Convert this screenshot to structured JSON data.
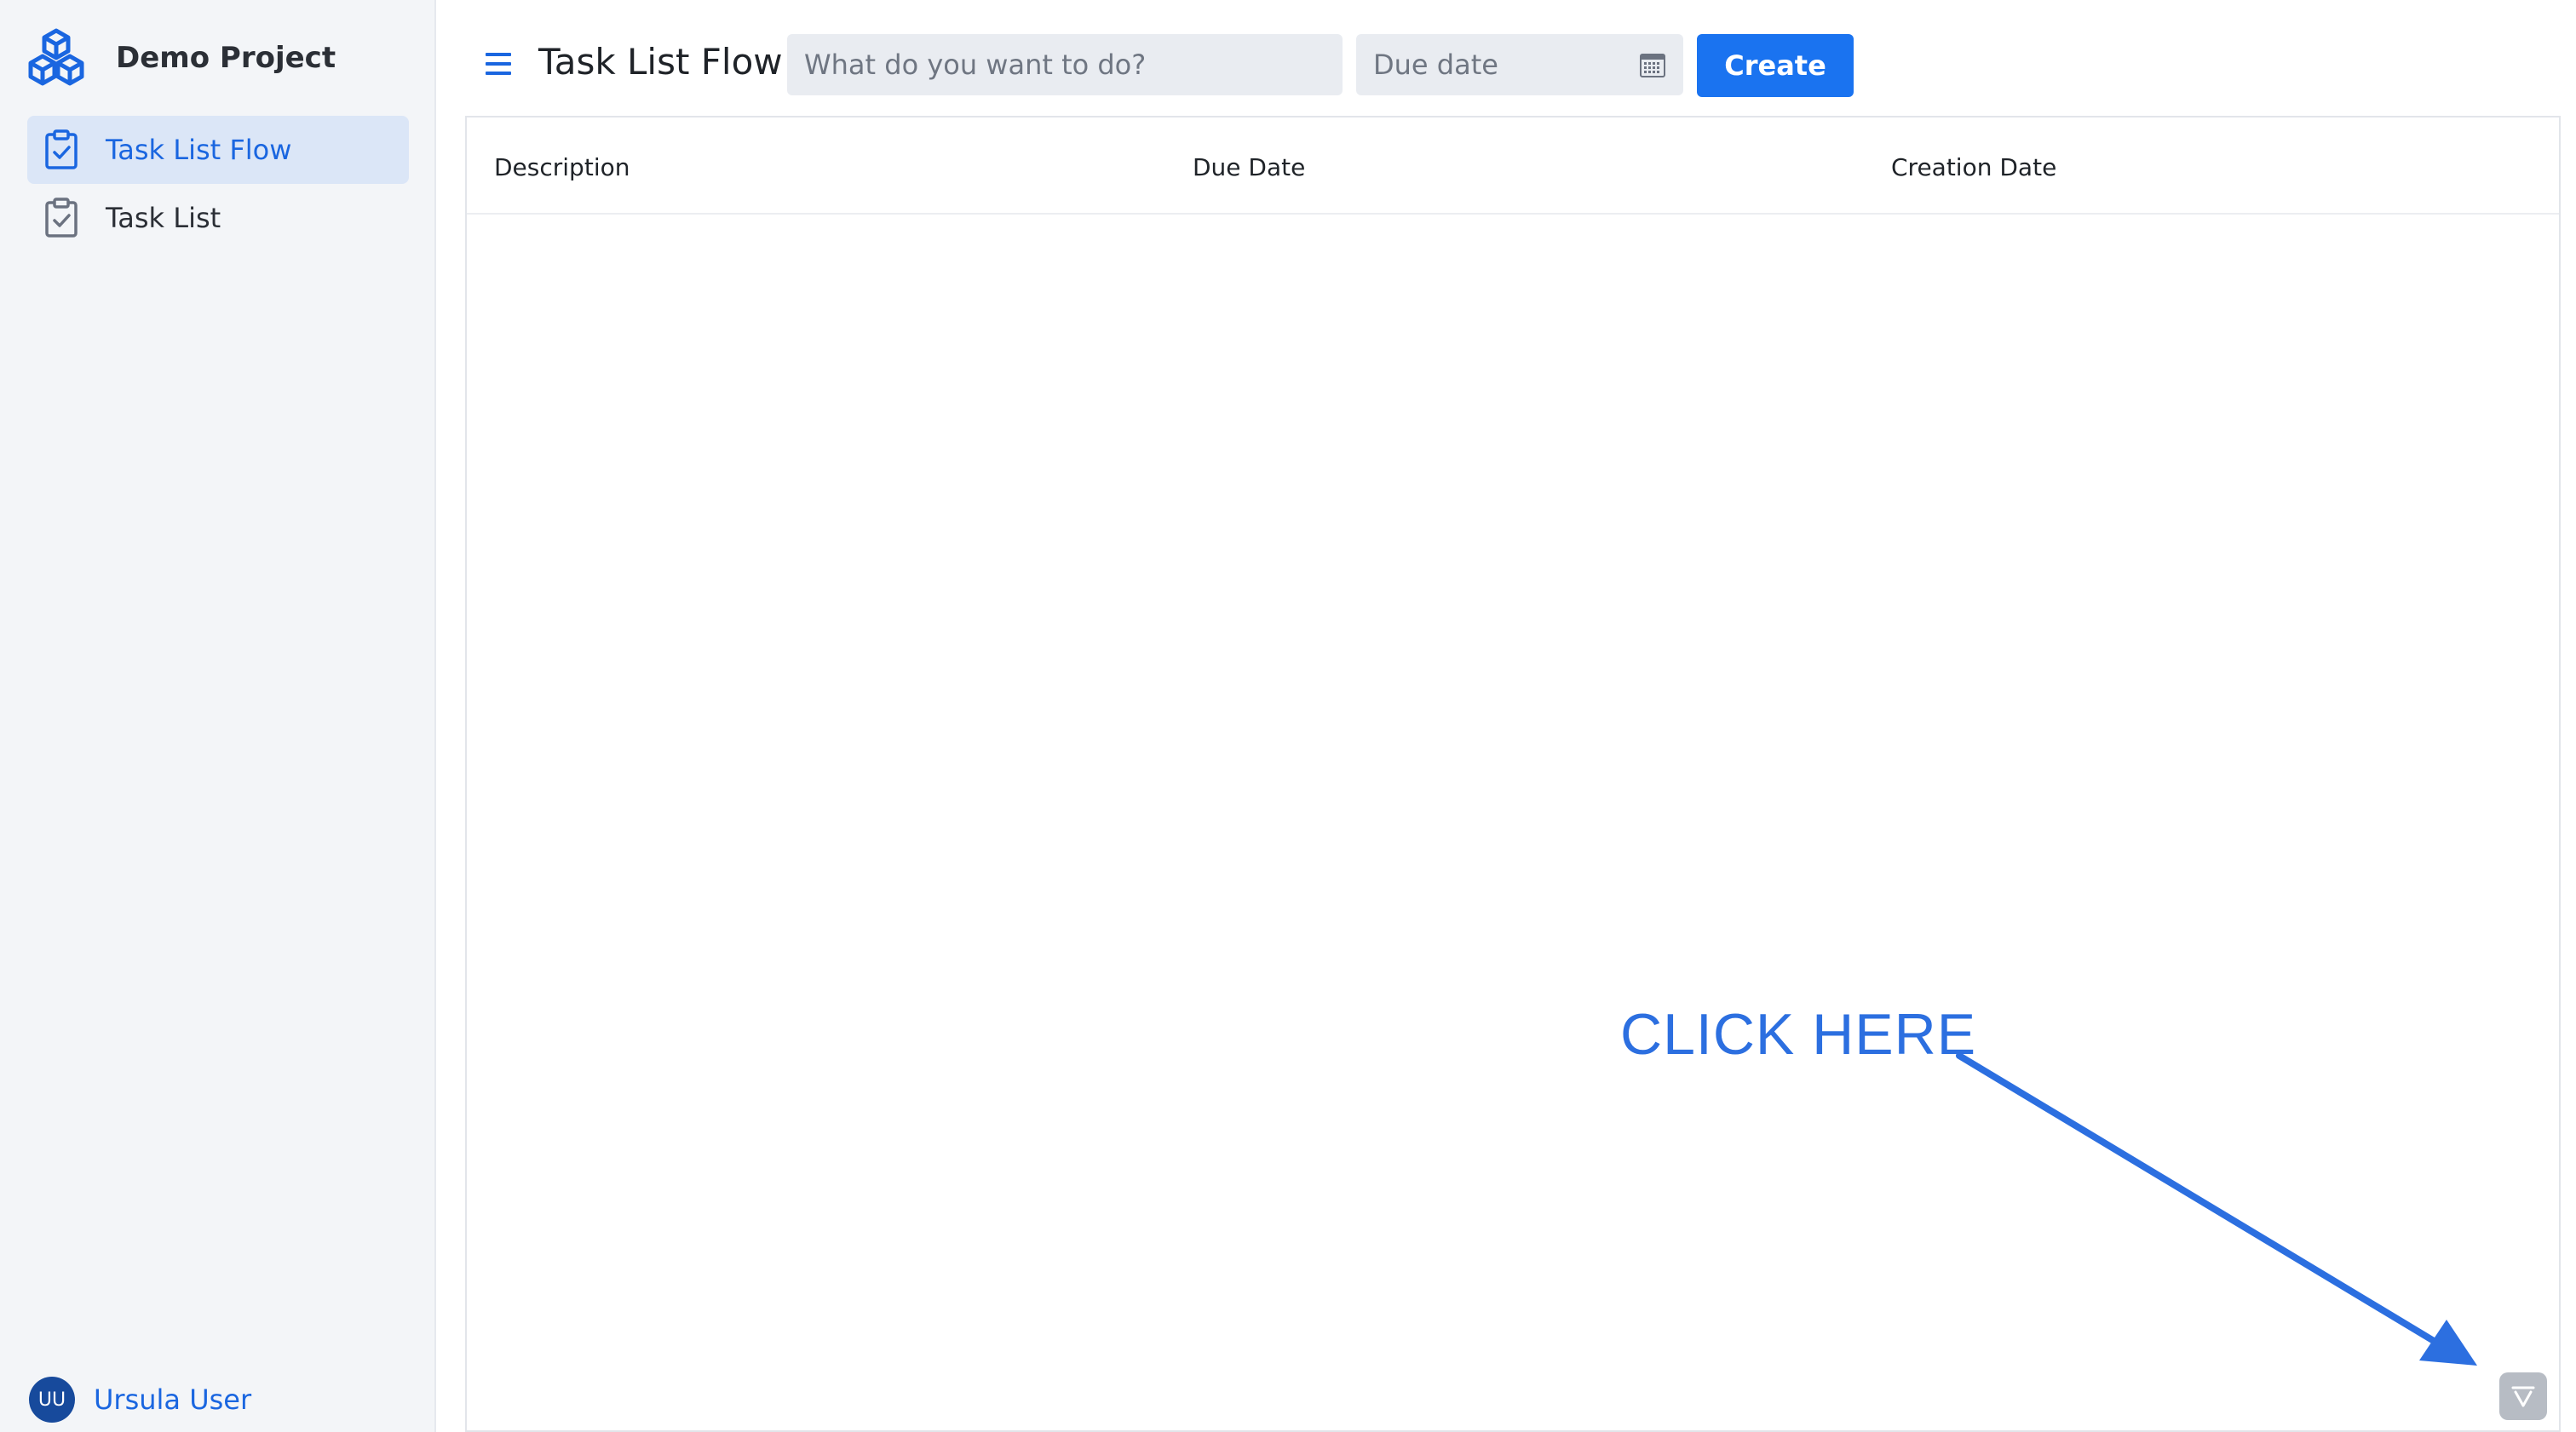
{
  "sidebar": {
    "brand": {
      "title": "Demo Project",
      "icon": "cubes-logo-icon"
    },
    "items": [
      {
        "label": "Task List Flow",
        "icon": "clipboard-check-icon",
        "active": true
      },
      {
        "label": "Task List",
        "icon": "clipboard-check-icon",
        "active": false
      }
    ],
    "user": {
      "initials": "UU",
      "name": "Ursula User"
    }
  },
  "header": {
    "title": "Task List Flow",
    "task_input": {
      "placeholder": "What do you want to do?",
      "value": ""
    },
    "due_date_input": {
      "placeholder": "Due date",
      "value": ""
    },
    "create_label": "Create"
  },
  "grid": {
    "columns": [
      "Description",
      "Due Date",
      "Creation Date"
    ],
    "rows": []
  },
  "annotation": {
    "text": "CLICK HERE"
  },
  "colors": {
    "accent": "#1a73f0",
    "sidebar_bg": "#f3f5f8",
    "active_item_bg": "#dbe6f7",
    "annotation": "#2c6fe0"
  }
}
